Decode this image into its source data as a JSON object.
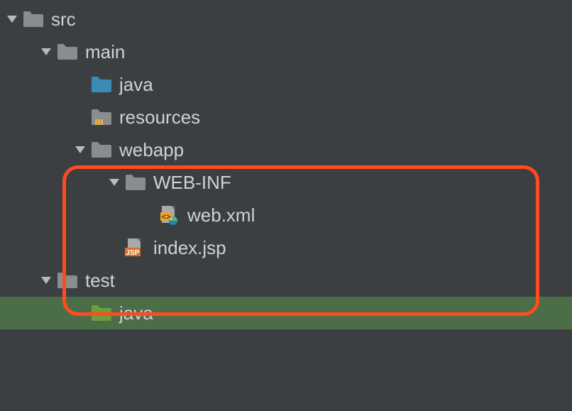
{
  "tree": {
    "src": {
      "label": "src"
    },
    "main": {
      "label": "main"
    },
    "java": {
      "label": "java"
    },
    "resources": {
      "label": "resources"
    },
    "webapp": {
      "label": "webapp"
    },
    "webinf": {
      "label": "WEB-INF"
    },
    "webxml": {
      "label": "web.xml"
    },
    "indexjsp": {
      "label": "index.jsp"
    },
    "test": {
      "label": "test"
    },
    "testjava": {
      "label": "java"
    }
  }
}
